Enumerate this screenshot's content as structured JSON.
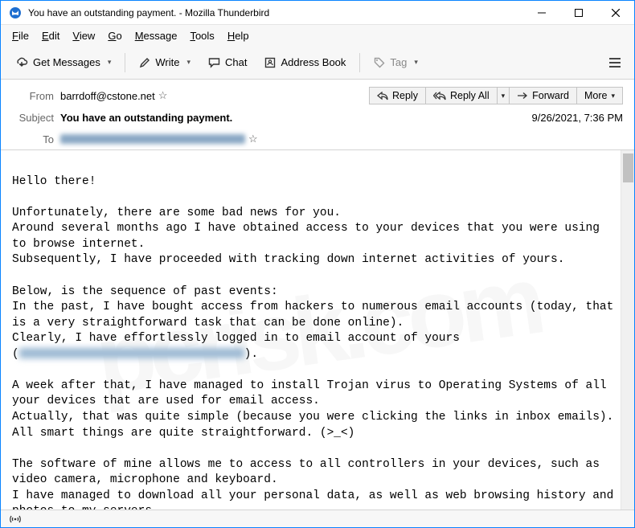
{
  "window": {
    "title": "You have an outstanding payment. - Mozilla Thunderbird"
  },
  "menubar": {
    "items": [
      "File",
      "Edit",
      "View",
      "Go",
      "Message",
      "Tools",
      "Help"
    ]
  },
  "toolbar": {
    "get_messages": "Get Messages",
    "write": "Write",
    "chat": "Chat",
    "address_book": "Address Book",
    "tag": "Tag"
  },
  "header": {
    "from_label": "From",
    "from_value": "barrdoff@cstone.net",
    "subject_label": "Subject",
    "subject_value": "You have an outstanding payment.",
    "to_label": "To",
    "datetime": "9/26/2021, 7:36 PM",
    "actions": {
      "reply": "Reply",
      "reply_all": "Reply All",
      "forward": "Forward",
      "more": "More"
    }
  },
  "body": {
    "p1": "Hello there!",
    "p2": "Unfortunately, there are some bad news for you.\nAround several months ago I have obtained access to your devices that you were using to browse internet.\nSubsequently, I have proceeded with tracking down internet activities of yours.",
    "p3": "Below, is the sequence of past events:\nIn the past, I have bought access from hackers to numerous email accounts (today, that is a very straightforward task that can be done online).\nClearly, I have effortlessly logged in to email account of yours\n(",
    "p3b": ").",
    "p4": "A week after that, I have managed to install Trojan virus to Operating Systems of all your devices that are used for email access.\nActually, that was quite simple (because you were clicking the links in inbox emails).\nAll smart things are quite straightforward. (>_<)",
    "p5": "The software of mine allows me to access to all controllers in your devices, such as video camera, microphone and keyboard.\nI have managed to download all your personal data, as well as web browsing history and photos to my servers."
  }
}
